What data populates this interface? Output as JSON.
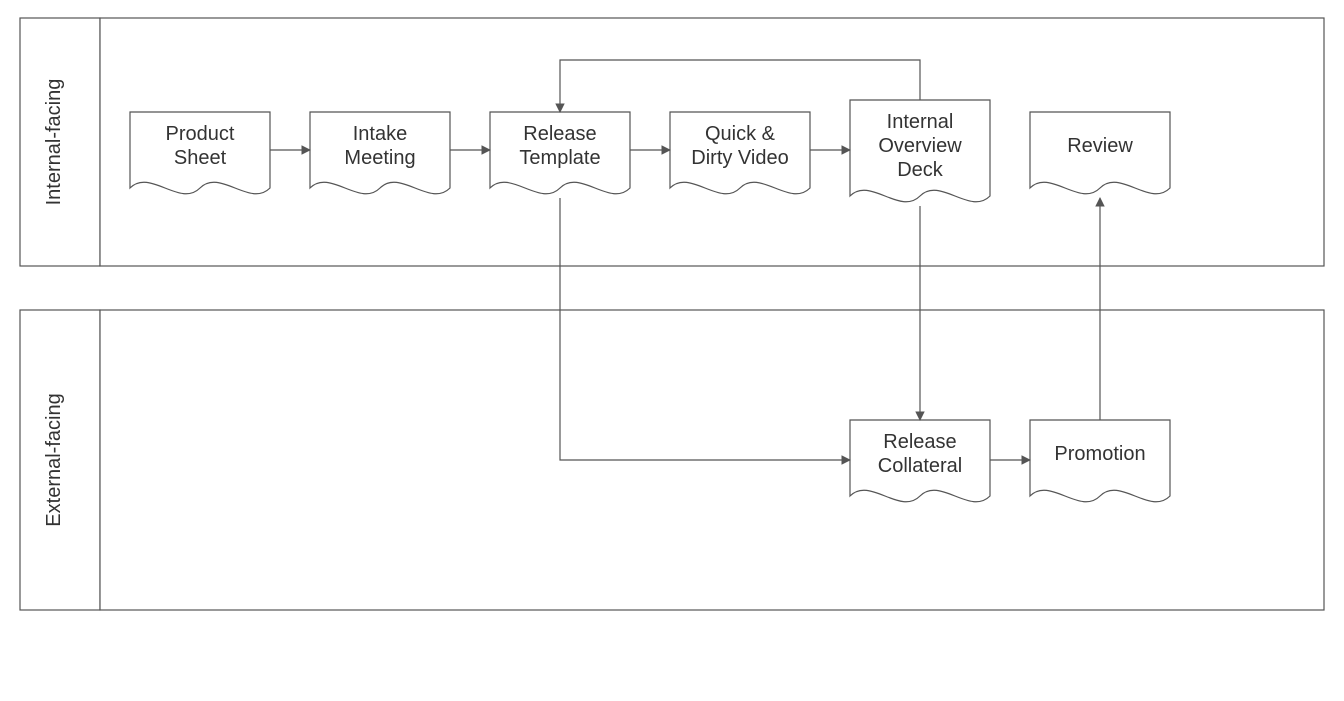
{
  "lanes": {
    "internal": "Internal-facing",
    "external": "External-facing"
  },
  "nodes": {
    "product_sheet": {
      "l1": "Product",
      "l2": "Sheet"
    },
    "intake_meeting": {
      "l1": "Intake",
      "l2": "Meeting"
    },
    "release_template": {
      "l1": "Release",
      "l2": "Template"
    },
    "quick_dirty": {
      "l1": "Quick &",
      "l2": "Dirty Video"
    },
    "overview_deck": {
      "l1": "Internal",
      "l2": "Overview",
      "l3": "Deck"
    },
    "review": {
      "l1": "Review"
    },
    "release_collateral": {
      "l1": "Release",
      "l2": "Collateral"
    },
    "promotion": {
      "l1": "Promotion"
    }
  },
  "chart_data": {
    "type": "table",
    "description": "Swimlane process diagram with two lanes.",
    "lanes": [
      "Internal-facing",
      "External-facing"
    ],
    "steps": [
      {
        "id": "product_sheet",
        "lane": "Internal-facing",
        "label": "Product Sheet"
      },
      {
        "id": "intake_meeting",
        "lane": "Internal-facing",
        "label": "Intake Meeting"
      },
      {
        "id": "release_template",
        "lane": "Internal-facing",
        "label": "Release Template"
      },
      {
        "id": "quick_dirty",
        "lane": "Internal-facing",
        "label": "Quick & Dirty Video"
      },
      {
        "id": "overview_deck",
        "lane": "Internal-facing",
        "label": "Internal Overview Deck"
      },
      {
        "id": "review",
        "lane": "Internal-facing",
        "label": "Review"
      },
      {
        "id": "release_collateral",
        "lane": "External-facing",
        "label": "Release Collateral"
      },
      {
        "id": "promotion",
        "lane": "External-facing",
        "label": "Promotion"
      }
    ],
    "edges": [
      [
        "product_sheet",
        "intake_meeting"
      ],
      [
        "intake_meeting",
        "release_template"
      ],
      [
        "release_template",
        "quick_dirty"
      ],
      [
        "quick_dirty",
        "overview_deck"
      ],
      [
        "overview_deck",
        "release_template"
      ],
      [
        "release_template",
        "release_collateral"
      ],
      [
        "overview_deck",
        "release_collateral"
      ],
      [
        "release_collateral",
        "promotion"
      ],
      [
        "promotion",
        "review"
      ]
    ]
  }
}
